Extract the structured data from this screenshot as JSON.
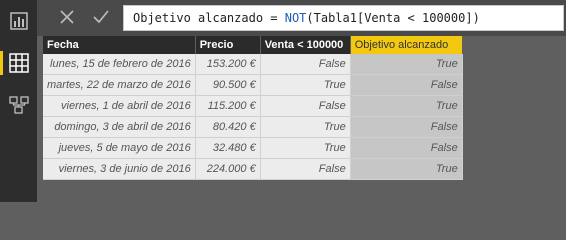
{
  "formula": {
    "prefix": "Objetivo alcanzado = ",
    "function": "NOT",
    "suffix": "(Tabla1[Venta < 100000])"
  },
  "table": {
    "headers": [
      "Fecha",
      "Precio",
      "Venta < 100000",
      "Objetivo alcanzado"
    ],
    "rows": [
      [
        "lunes, 15 de febrero de 2016",
        "153.200 €",
        "False",
        "True"
      ],
      [
        "martes, 22 de marzo de 2016",
        "90.500 €",
        "True",
        "False"
      ],
      [
        "viernes, 1 de abril de 2016",
        "115.200 €",
        "False",
        "True"
      ],
      [
        "domingo, 3 de abril de 2016",
        "80.420 €",
        "True",
        "False"
      ],
      [
        "jueves, 5 de mayo de 2016",
        "32.480 €",
        "True",
        "False"
      ],
      [
        "viernes, 3 de junio de 2016",
        "224.000 €",
        "False",
        "True"
      ]
    ]
  },
  "sidebar": {
    "items": [
      {
        "icon": "report-view-icon"
      },
      {
        "icon": "data-view-icon",
        "active": true
      },
      {
        "icon": "relationships-view-icon"
      }
    ]
  },
  "colors": {
    "accent": "#f2c811",
    "header": "#2b2b2b",
    "keyword": "#1d5fb8"
  }
}
